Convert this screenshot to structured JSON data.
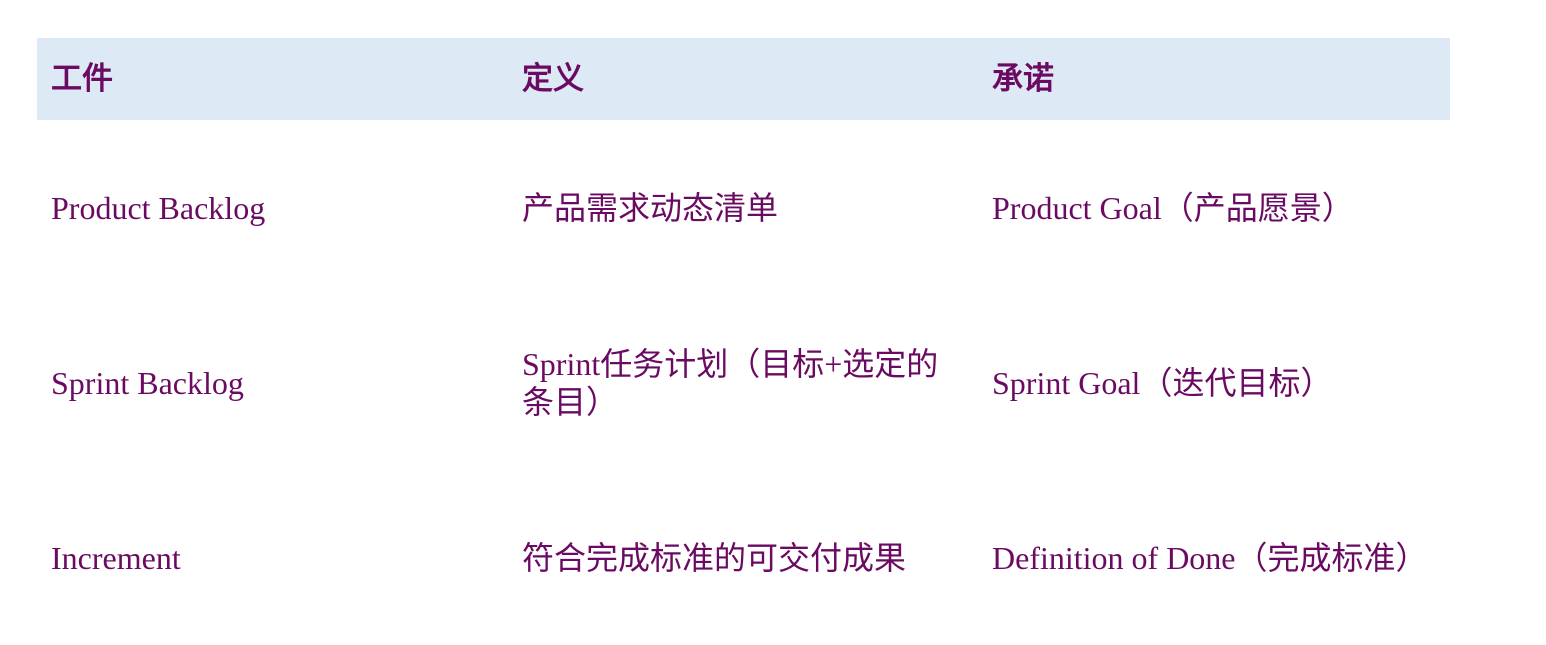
{
  "table": {
    "headers": [
      "工件",
      "定义",
      "承诺"
    ],
    "rows": [
      [
        "Product Backlog",
        "产品需求动态清单",
        "Product Goal（产品愿景）"
      ],
      [
        "Sprint Backlog",
        "Sprint任务计划（目标+选定的条目）",
        "Sprint Goal（迭代目标）"
      ],
      [
        "Increment",
        "符合完成标准的可交付成果",
        "Definition of Done（完成标准）"
      ]
    ]
  },
  "colors": {
    "header_bg": "#dde9f5",
    "text": "#6a0a62"
  }
}
